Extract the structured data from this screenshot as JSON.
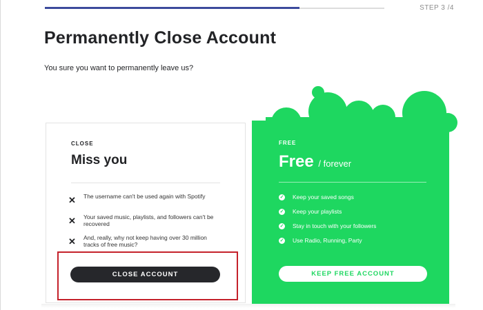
{
  "progress": {
    "fraction": 0.75
  },
  "step_label": "STEP 3 /4",
  "page": {
    "title": "Permanently Close Account",
    "subtitle": "You sure you want to permanently leave us?"
  },
  "close_card": {
    "eyebrow": "CLOSE",
    "heading": "Miss you",
    "reasons": [
      "The username can't be used again with Spotify",
      "Your saved music, playlists, and followers can't be recovered",
      "And, really, why not keep having over 30 million tracks of free music?"
    ],
    "button_label": "CLOSE ACCOUNT"
  },
  "free_card": {
    "eyebrow": "FREE",
    "heading": "Free",
    "heading_suffix": "/ forever",
    "features": [
      "Keep your saved songs",
      "Keep your playlists",
      "Stay in touch with your followers",
      "Use Radio, Running, Party"
    ],
    "button_label": "KEEP FREE ACCOUNT"
  },
  "colors": {
    "accent_green": "#1ed760",
    "progress_blue": "#3b4a9c",
    "dark_button": "#26272b",
    "highlight_red": "#c4202a"
  }
}
